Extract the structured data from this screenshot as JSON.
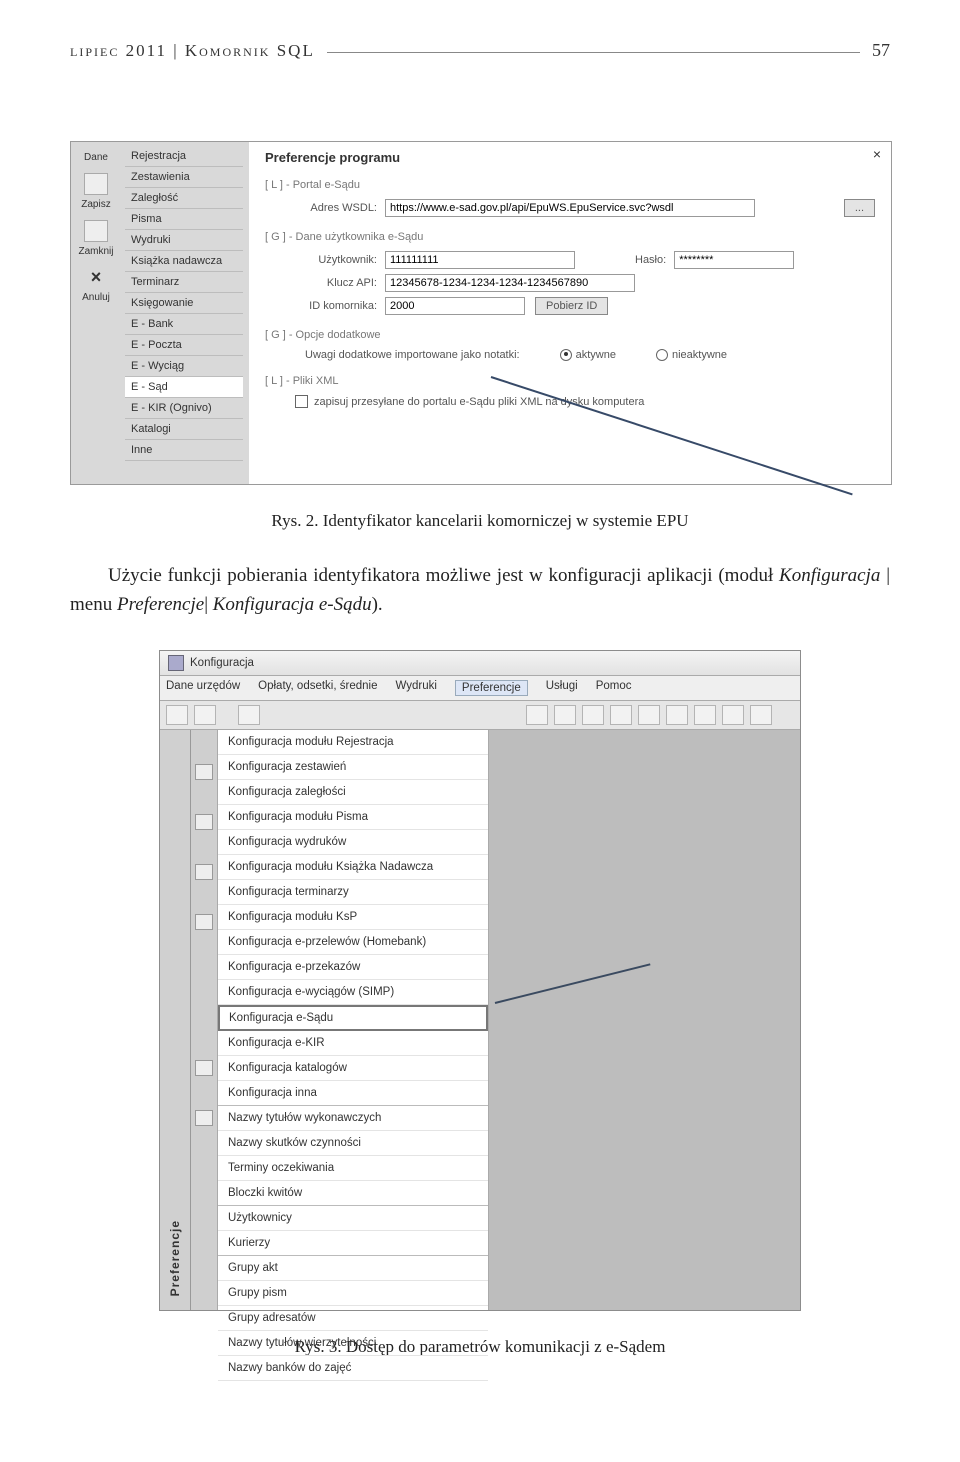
{
  "header": {
    "left": "lipiec 2011 | Komornik SQL",
    "page": "57"
  },
  "shot1": {
    "leftbar": {
      "dane": "Dane",
      "zapisz": "Zapisz",
      "zamknij": "Zamknij",
      "anuluj": "Anuluj"
    },
    "menu": [
      "Rejestracja",
      "Zestawienia",
      "Zaległość",
      "Pisma",
      "Wydruki",
      "Książka nadawcza",
      "Terminarz",
      "Księgowanie",
      "E - Bank",
      "E - Poczta",
      "E - Wyciąg",
      "E - Sąd",
      "E - KIR (Ognivo)",
      "Katalogi",
      "Inne"
    ],
    "menu_selected_index": 11,
    "title": "Preferencje programu",
    "close": "×",
    "group1": "[ L ] - Portal e-Sądu",
    "wsdl_lbl": "Adres WSDL:",
    "wsdl_val": "https://www.e-sad.gov.pl/api/EpuWS.EpuService.svc?wsdl",
    "wsdl_btn": "...",
    "group2": "[ G ] - Dane użytkownika e-Sądu",
    "user_lbl": "Użytkownik:",
    "user_val": "111111111",
    "pass_lbl": "Hasło:",
    "pass_val": "********",
    "api_lbl": "Klucz API:",
    "api_val": "12345678-1234-1234-1234-1234567890",
    "id_lbl": "ID komornika:",
    "id_val": "2000",
    "id_btn": "Pobierz ID",
    "group3": "[ G ] - Opcje dodatkowe",
    "opt_lbl": "Uwagi dodatkowe importowane jako notatki:",
    "opt_a": "aktywne",
    "opt_b": "nieaktywne",
    "group4": "[ L ] - Pliki XML",
    "chk_lbl": "zapisuj przesyłane do portalu e-Sądu pliki XML na dysku komputera"
  },
  "caption1": "Rys. 2. Identyfikator kancelarii komorniczej w systemie EPU",
  "paragraph": {
    "p1": "Użycie funkcji pobierania identyfikatora możliwe jest w konfiguracji aplikacji (moduł ",
    "i1": "Konfiguracja",
    "p2": " | menu ",
    "i2": "Preferencje",
    "p3": "| ",
    "i3": "Konfiguracja e-Sądu",
    "p4": ")."
  },
  "shot2": {
    "title": "Konfiguracja",
    "menubar": [
      "Dane urzędów",
      "Opłaty, odsetki, średnie",
      "Wydruki",
      "Preferencje",
      "Usługi",
      "Pomoc"
    ],
    "menubar_selected_index": 3,
    "sidetab": "Preferencje",
    "items": [
      "Konfiguracja modułu Rejestracja",
      "Konfiguracja zestawień",
      "Konfiguracja zaległości",
      "Konfiguracja modułu Pisma",
      "Konfiguracja wydruków",
      "Konfiguracja modułu Książka Nadawcza",
      "Konfiguracja terminarzy",
      "Konfiguracja modułu KsP",
      "Konfiguracja e-przelewów (Homebank)",
      "Konfiguracja e-przekazów",
      "Konfiguracja e-wyciągów (SIMP)",
      "Konfiguracja e-Sądu",
      "Konfiguracja e-KIR",
      "Konfiguracja katalogów",
      "Konfiguracja inna"
    ],
    "selected_index": 11,
    "items2": [
      "Nazwy tytułów wykonawczych",
      "Nazwy skutków czynności",
      "Terminy oczekiwania",
      "Bloczki kwitów"
    ],
    "items3": [
      "Użytkownicy",
      "Kurierzy"
    ],
    "items4": [
      "Grupy akt",
      "Grupy pism",
      "Grupy adresatów",
      "Nazwy tytułów wierzytelności",
      "Nazwy banków do zajęć"
    ]
  },
  "caption2": "Rys. 3. Dostęp do parametrów komunikacji z e-Sądem"
}
